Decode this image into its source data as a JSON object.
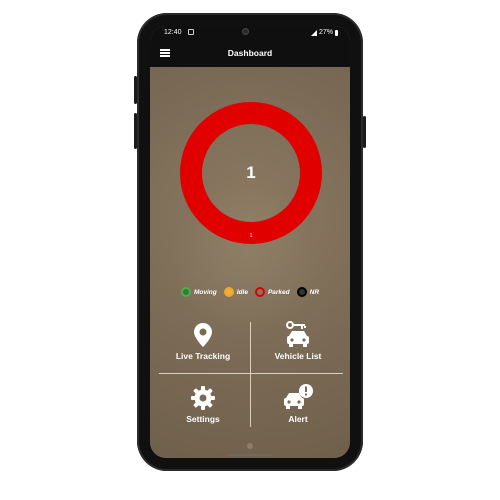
{
  "status": {
    "time": "12:40",
    "battery": "27%"
  },
  "appbar": {
    "title": "Dashboard"
  },
  "summary": {
    "total": "1",
    "slice_label": "1"
  },
  "chart_data": {
    "type": "pie",
    "categories": [
      "Moving",
      "Idle",
      "Parked",
      "NR"
    ],
    "values": [
      0,
      0,
      1,
      0
    ]
  },
  "legend": [
    {
      "label": "Moving",
      "color": "#4caf50",
      "icon": "moving-icon"
    },
    {
      "label": "Idle",
      "color": "#f5a623",
      "icon": "idle-icon"
    },
    {
      "label": "Parked",
      "color": "#e00000",
      "icon": "parked-icon"
    },
    {
      "label": "NR",
      "color": "#000000",
      "icon": "nr-icon"
    }
  ],
  "tiles": {
    "live_tracking": {
      "label": "Live Tracking",
      "icon": "location-pin-icon"
    },
    "vehicle_list": {
      "label": "Vehicle List",
      "icon": "car-key-icon"
    },
    "settings": {
      "label": "Settings",
      "icon": "gear-icon"
    },
    "alert": {
      "label": "Alert",
      "icon": "car-alert-icon"
    }
  },
  "colors": {
    "parked_ring": "#e00000",
    "background": "#7a6a55",
    "bar": "#0f0f0f"
  }
}
